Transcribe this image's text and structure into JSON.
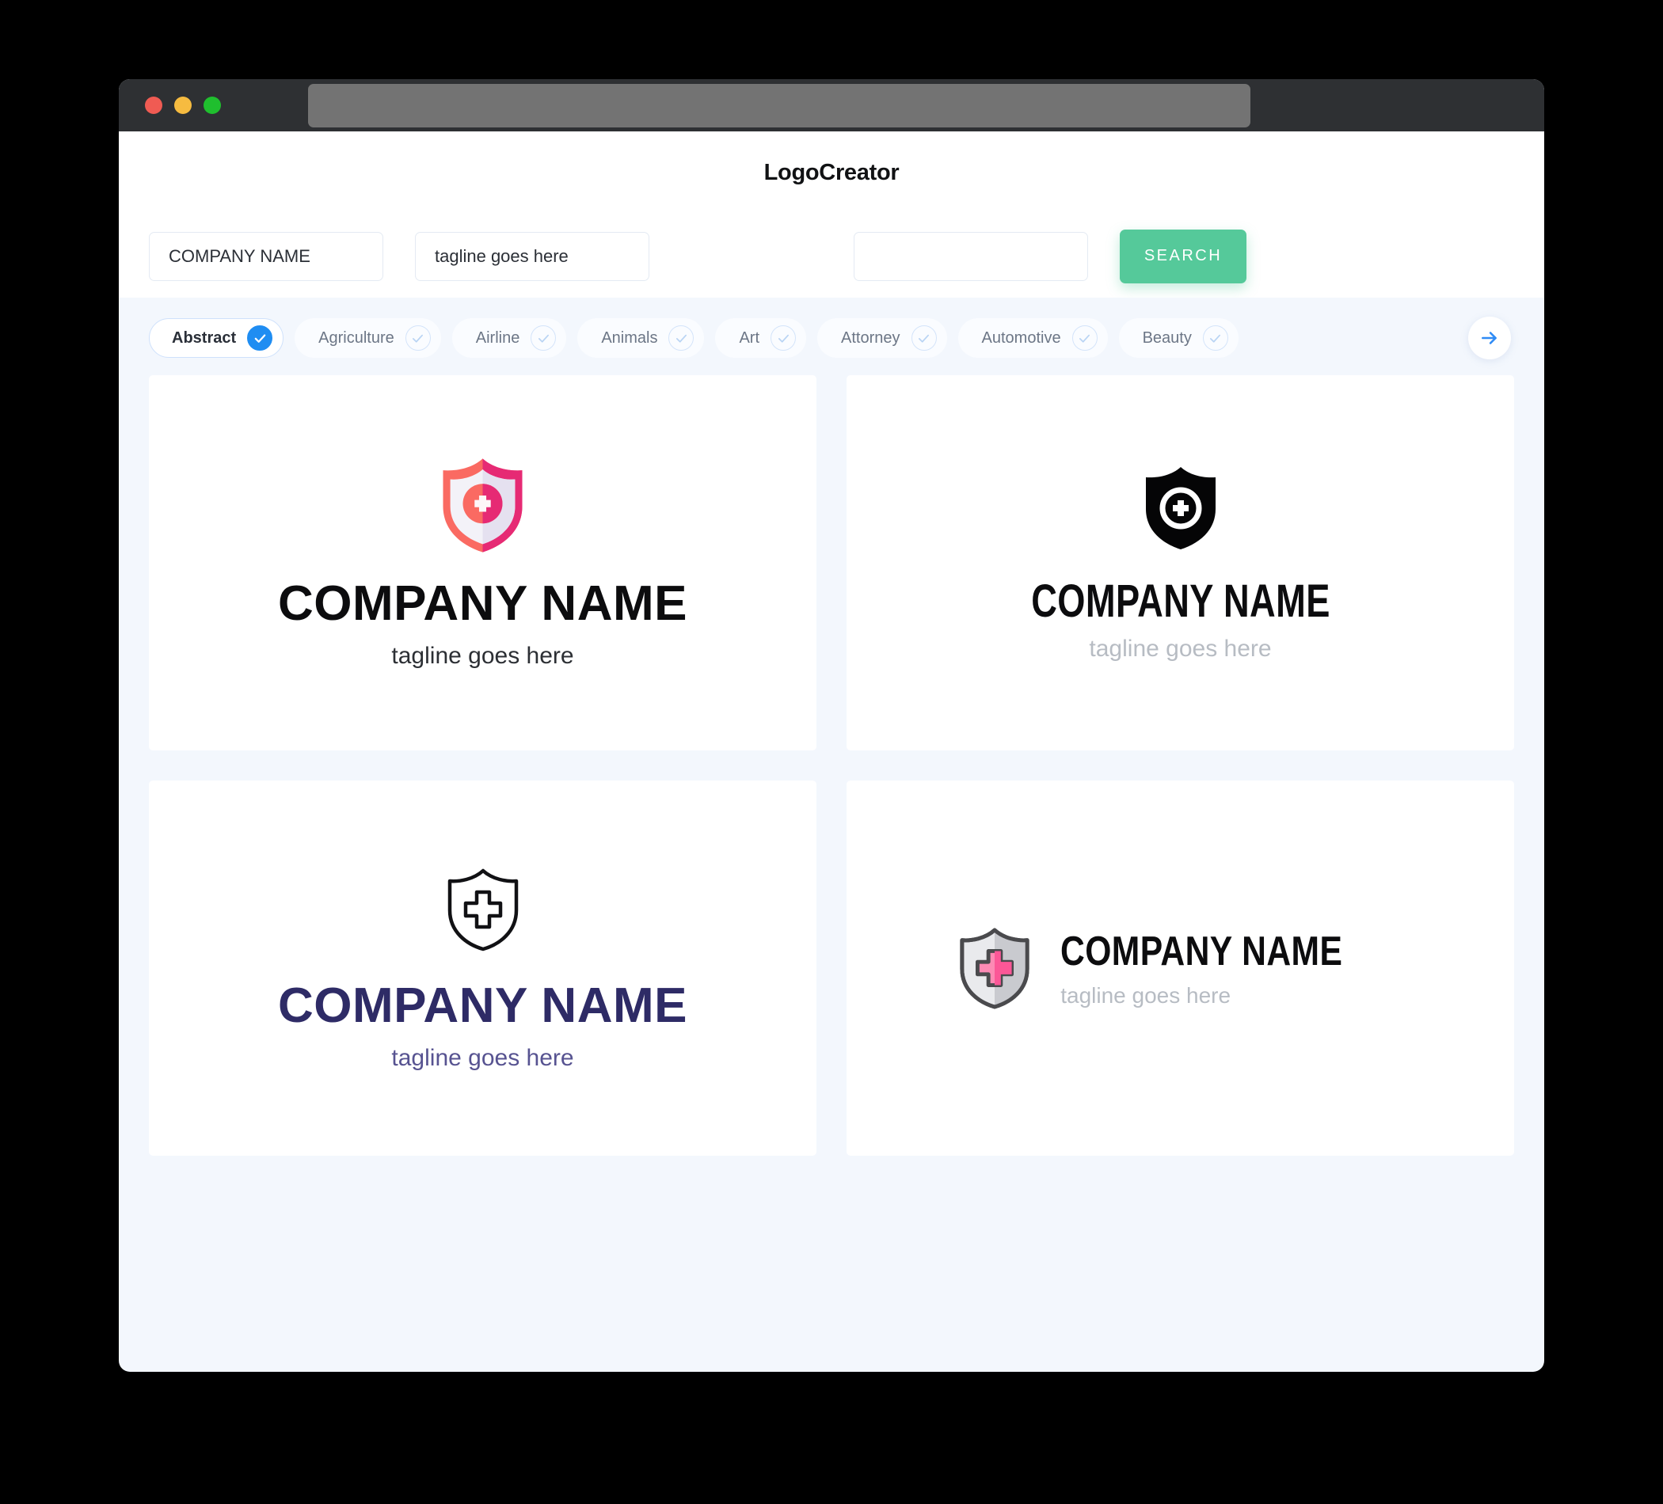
{
  "window": {
    "traffic_lights": [
      "close",
      "minimize",
      "maximize"
    ],
    "url_value": ""
  },
  "header": {
    "title": "LogoCreator"
  },
  "search": {
    "company_value": "COMPANY NAME",
    "company_placeholder": "COMPANY NAME",
    "tagline_value": "tagline goes here",
    "tagline_placeholder": "tagline goes here",
    "extra_value": "",
    "extra_placeholder": "",
    "search_label": "SEARCH"
  },
  "categories": {
    "next_icon": "arrow-right-icon",
    "items": [
      {
        "label": "Abstract",
        "selected": true,
        "icon": "check-icon"
      },
      {
        "label": "Agriculture",
        "selected": false,
        "icon": "check-icon"
      },
      {
        "label": "Airline",
        "selected": false,
        "icon": "check-icon"
      },
      {
        "label": "Animals",
        "selected": false,
        "icon": "check-icon"
      },
      {
        "label": "Art",
        "selected": false,
        "icon": "check-icon"
      },
      {
        "label": "Attorney",
        "selected": false,
        "icon": "check-icon"
      },
      {
        "label": "Automotive",
        "selected": false,
        "icon": "check-icon"
      },
      {
        "label": "Beauty",
        "selected": false,
        "icon": "check-icon"
      }
    ]
  },
  "results": {
    "cards": [
      {
        "id": "logo-card-1",
        "icon": "shield-plus-gradient-icon",
        "layout": "stacked",
        "name": "COMPANY NAME",
        "tagline": "tagline goes here",
        "name_color": "#0c0c0e",
        "tagline_color": "#2c2f34"
      },
      {
        "id": "logo-card-2",
        "icon": "shield-plus-solid-black-icon",
        "layout": "stacked",
        "name": "COMPANY NAME",
        "tagline": "tagline goes here",
        "name_color": "#0c0c0e",
        "tagline_color": "#b7bcc3"
      },
      {
        "id": "logo-card-3",
        "icon": "shield-cross-outline-icon",
        "layout": "stacked",
        "name": "COMPANY NAME",
        "tagline": "tagline goes here",
        "name_color": "#2e2b66",
        "tagline_color": "#575391"
      },
      {
        "id": "logo-card-4",
        "icon": "shield-cross-gray-pink-icon",
        "layout": "horizontal",
        "name": "COMPANY NAME",
        "tagline": "tagline goes here",
        "name_color": "#0c0c0e",
        "tagline_color": "#b7bcc3"
      }
    ]
  },
  "colors": {
    "page_background": "#f3f7fd",
    "card_background": "#ffffff",
    "accent_green": "#55c99a",
    "accent_blue": "#1f8df2",
    "titlebar": "#2e3033",
    "shield_pink_light": "#fa6a62",
    "shield_pink_dark": "#e62a74",
    "shield_gray": "#d9dade"
  }
}
